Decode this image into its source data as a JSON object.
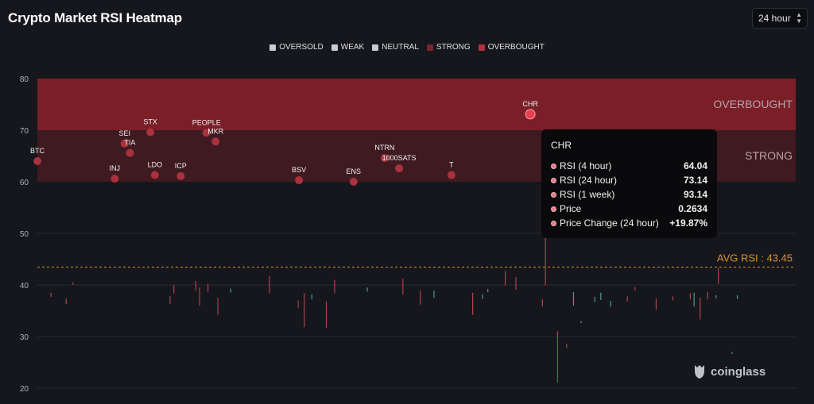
{
  "title": "Crypto Market RSI Heatmap",
  "timeframe": {
    "selected": "24 hour"
  },
  "legend": [
    {
      "label": "OVERSOLD",
      "color": "#c9cbd0"
    },
    {
      "label": "WEAK",
      "color": "#c9cbd0"
    },
    {
      "label": "NEUTRAL",
      "color": "#c9cbd0"
    },
    {
      "label": "STRONG",
      "color": "#7a2530"
    },
    {
      "label": "OVERBOUGHT",
      "color": "#b3303f"
    }
  ],
  "tooltip": {
    "title": "CHR",
    "rows": [
      {
        "label": "RSI (4 hour)",
        "value": "64.04"
      },
      {
        "label": "RSI (24 hour)",
        "value": "73.14"
      },
      {
        "label": "RSI (1 week)",
        "value": "93.14"
      },
      {
        "label": "Price",
        "value": "0.2634"
      },
      {
        "label": "Price Change (24 hour)",
        "value": "+19.87%"
      }
    ]
  },
  "brand": "coinglass",
  "chart_data": {
    "type": "scatter",
    "ylim": [
      20,
      80
    ],
    "yticks": [
      20,
      30,
      40,
      50,
      60,
      70,
      80
    ],
    "xlim": [
      0,
      100
    ],
    "zones": [
      {
        "label": "OVERBOUGHT",
        "from": 70,
        "to": 80,
        "color": "#7a1f28"
      },
      {
        "label": "STRONG",
        "from": 60,
        "to": 70,
        "color": "#3f1a20"
      }
    ],
    "avg_line": {
      "label": "AVG RSI : 43.45",
      "value": 43.45,
      "color": "#d9922e"
    },
    "points": [
      {
        "name": "BTC",
        "x": 0,
        "y": 64.0
      },
      {
        "name": "INJ",
        "x": 10.2,
        "y": 60.6
      },
      {
        "name": "SEI",
        "x": 11.5,
        "y": 67.4
      },
      {
        "name": "TIA",
        "x": 12.2,
        "y": 65.6
      },
      {
        "name": "STX",
        "x": 14.9,
        "y": 69.6
      },
      {
        "name": "LDO",
        "x": 15.5,
        "y": 61.3
      },
      {
        "name": "ICP",
        "x": 18.9,
        "y": 61.1
      },
      {
        "name": "PEOPLE",
        "x": 22.3,
        "y": 69.5
      },
      {
        "name": "MKR",
        "x": 23.5,
        "y": 67.8
      },
      {
        "name": "BSV",
        "x": 34.5,
        "y": 60.3
      },
      {
        "name": "ENS",
        "x": 41.7,
        "y": 60.0
      },
      {
        "name": "NTRN",
        "x": 45.8,
        "y": 64.6
      },
      {
        "name": "1000SATS",
        "x": 47.7,
        "y": 62.6
      },
      {
        "name": "T",
        "x": 54.6,
        "y": 61.3
      },
      {
        "name": "CHR",
        "x": 65.0,
        "y": 73.1
      }
    ],
    "highlighted": "CHR",
    "background_ticks": [
      [
        1.8,
        38.5,
        37.7,
        "#c94a55"
      ],
      [
        3.8,
        37.4,
        36.3,
        "#c94a55"
      ],
      [
        4.7,
        40.5,
        40.0,
        "#c94a55"
      ],
      [
        17.5,
        37.8,
        36.3,
        "#c94a55"
      ],
      [
        18.0,
        40.0,
        38.4,
        "#c94a55"
      ],
      [
        20.9,
        40.8,
        38.9,
        "#c94a55"
      ],
      [
        21.4,
        39.5,
        36.0,
        "#c94a55"
      ],
      [
        22.5,
        40.2,
        38.7,
        "#c94a55"
      ],
      [
        23.8,
        37.5,
        34.2,
        "#c94a55"
      ],
      [
        25.5,
        39.3,
        38.5,
        "#56b4a0"
      ],
      [
        30.6,
        41.7,
        38.4,
        "#c94a55"
      ],
      [
        34.4,
        37.0,
        35.6,
        "#c94a55"
      ],
      [
        35.2,
        38.4,
        31.8,
        "#c94a55"
      ],
      [
        36.2,
        38.2,
        37.2,
        "#56b4a0"
      ],
      [
        38.1,
        36.8,
        31.7,
        "#c94a55"
      ],
      [
        39.2,
        41.0,
        38.4,
        "#c94a55"
      ],
      [
        43.5,
        39.5,
        38.7,
        "#56b4a0"
      ],
      [
        48.2,
        41.2,
        38.1,
        "#c94a55"
      ],
      [
        50.5,
        39.0,
        36.2,
        "#c94a55"
      ],
      [
        52.3,
        38.9,
        37.5,
        "#56b4a0"
      ],
      [
        57.4,
        38.5,
        34.2,
        "#c94a55"
      ],
      [
        58.7,
        38.2,
        37.3,
        "#56b4a0"
      ],
      [
        59.4,
        39.2,
        38.6,
        "#56b4a0"
      ],
      [
        61.7,
        42.7,
        39.9,
        "#c94a55"
      ],
      [
        63.1,
        41.5,
        39.1,
        "#c94a55"
      ],
      [
        67.0,
        49.5,
        39.9,
        "#c94a55"
      ],
      [
        66.6,
        37.2,
        35.8,
        "#c94a55"
      ],
      [
        68.6,
        31.0,
        21.1,
        "#c94a55"
      ],
      [
        69.8,
        28.6,
        27.8,
        "#c94a55"
      ],
      [
        70.7,
        38.6,
        36.0,
        "#56b4a0"
      ],
      [
        71.7,
        33.0,
        32.6,
        "#56b4a0"
      ],
      [
        73.5,
        37.7,
        36.7,
        "#56b4a0"
      ],
      [
        74.3,
        38.5,
        37.1,
        "#56b4a0"
      ],
      [
        75.6,
        36.9,
        35.8,
        "#56b4a0"
      ],
      [
        77.8,
        37.8,
        36.8,
        "#c94a55"
      ],
      [
        78.8,
        39.6,
        38.9,
        "#c94a55"
      ],
      [
        81.6,
        37.4,
        35.2,
        "#c94a55"
      ],
      [
        83.8,
        37.8,
        37.0,
        "#c94a55"
      ],
      [
        86.1,
        38.4,
        37.2,
        "#c94a55"
      ],
      [
        86.6,
        38.5,
        35.8,
        "#56b4a0"
      ],
      [
        87.4,
        37.5,
        33.3,
        "#c94a55"
      ],
      [
        88.4,
        38.7,
        37.2,
        "#c94a55"
      ],
      [
        89.5,
        38.0,
        37.4,
        "#56b4a0"
      ],
      [
        89.8,
        43.3,
        40.2,
        "#c94a55"
      ],
      [
        91.6,
        27.0,
        26.6,
        "#56b4a0"
      ],
      [
        92.3,
        38.0,
        37.3,
        "#56b4a0"
      ]
    ]
  }
}
